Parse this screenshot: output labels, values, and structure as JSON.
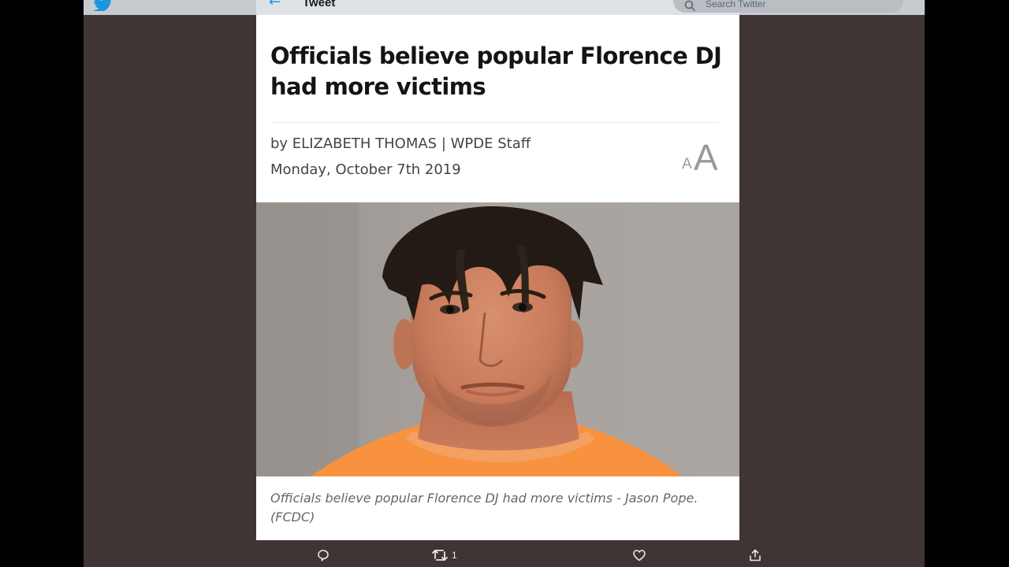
{
  "header": {
    "logo_icon": "twitter-bird-icon",
    "back_icon": "back-arrow-icon",
    "title": "Tweet",
    "search_placeholder": "Search Twitter"
  },
  "article": {
    "headline": "Officials believe popular Florence DJ had more victims",
    "byline": "by ELIZABETH THOMAS | WPDE Staff",
    "date": "Monday, October 7th 2019",
    "text_size_small": "A",
    "text_size_large": "A",
    "photo_icon": "mugshot-photo",
    "caption": "Officials believe popular Florence DJ had more victims - Jason Pope. (FCDC)"
  },
  "tweet_actions": {
    "reply_icon": "reply-icon",
    "retweet_icon": "retweet-icon",
    "retweet_count": "1",
    "like_icon": "heart-icon",
    "share_icon": "share-icon"
  },
  "colors": {
    "twitter_blue": "#1b95e0",
    "page_background": "#3f3535",
    "prison_orange": "#f8923f"
  }
}
